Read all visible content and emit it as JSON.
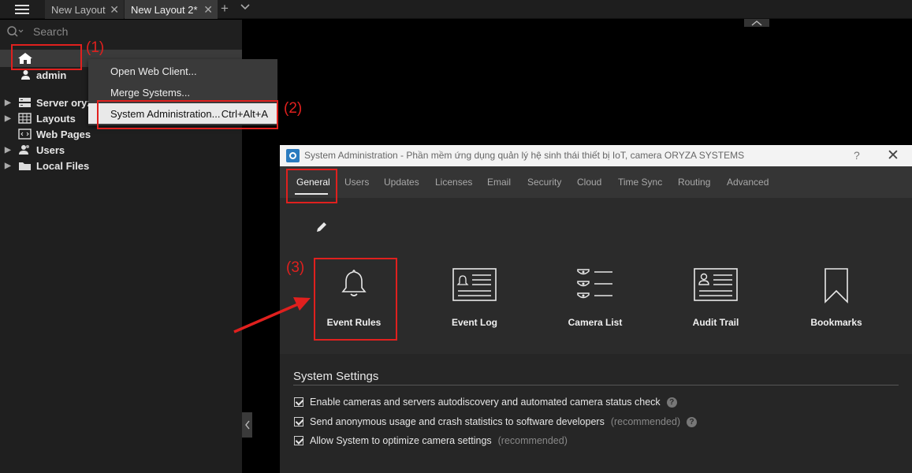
{
  "tabs": {
    "items": [
      {
        "label": "New Layout"
      },
      {
        "label": "New Layout 2*"
      }
    ],
    "add": "+",
    "more": "⌄"
  },
  "sidebar": {
    "search_placeholder": "Search",
    "user": "admin",
    "items": [
      {
        "label": "Server oryz"
      },
      {
        "label": "Layouts"
      },
      {
        "label": "Web Pages"
      },
      {
        "label": "Users"
      },
      {
        "label": "Local Files"
      }
    ]
  },
  "context_menu": {
    "items": [
      {
        "label": "Open Web Client..."
      },
      {
        "label": "Merge Systems..."
      },
      {
        "label": "System Administration...",
        "shortcut": "Ctrl+Alt+A"
      }
    ]
  },
  "annotations": {
    "a1": "(1)",
    "a2": "(2)",
    "a3": "(3)",
    "color": "#e0201e"
  },
  "dialog": {
    "title": "System Administration - Phần mềm ứng dụng quản lý hệ sinh thái thiết bị IoT, camera ORYZA SYSTEMS",
    "help": "?",
    "close": "✕",
    "tabs": [
      "General",
      "Users",
      "Updates",
      "Licenses",
      "Email",
      "Security",
      "Cloud",
      "Time Sync",
      "Routing",
      "Advanced"
    ],
    "active_tab": "General",
    "tiles": [
      {
        "label": "Event Rules",
        "icon": "bell-icon"
      },
      {
        "label": "Event Log",
        "icon": "event-log-icon"
      },
      {
        "label": "Camera List",
        "icon": "camera-list-icon"
      },
      {
        "label": "Audit Trail",
        "icon": "audit-trail-icon"
      },
      {
        "label": "Bookmarks",
        "icon": "bookmark-icon"
      }
    ],
    "settings": {
      "title": "System Settings",
      "checks": [
        {
          "label": "Enable cameras and servers autodiscovery and automated camera status check",
          "note": "",
          "checked": true
        },
        {
          "label": "Send anonymous usage and crash statistics to software developers",
          "note": "(recommended)",
          "checked": true
        },
        {
          "label": "Allow System to optimize camera settings",
          "note": "(recommended)",
          "checked": true
        }
      ]
    }
  }
}
